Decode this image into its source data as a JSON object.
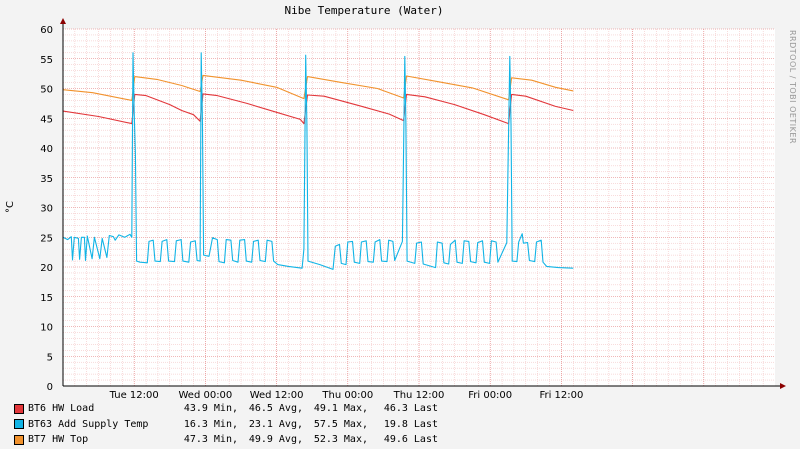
{
  "chart_data": {
    "type": "line",
    "title": "Nibe Temperature (Water)",
    "ylabel": "°C",
    "xlabel": "",
    "watermark": "RRDTOOL / TOBI OETIKER",
    "ylim": [
      0,
      60
    ],
    "y_ticks": [
      "0",
      "5",
      "10",
      "15",
      "20",
      "25",
      "30",
      "35",
      "40",
      "45",
      "50",
      "55",
      "60"
    ],
    "xlim": [
      0,
      120
    ],
    "x_ticks": [
      {
        "x": 12,
        "label": "Tue 12:00"
      },
      {
        "x": 24,
        "label": "Wed 00:00"
      },
      {
        "x": 36,
        "label": "Wed 12:00"
      },
      {
        "x": 48,
        "label": "Thu 00:00"
      },
      {
        "x": 60,
        "label": "Thu 12:00"
      },
      {
        "x": 72,
        "label": "Fri 00:00"
      },
      {
        "x": 84,
        "label": "Fri 12:00"
      }
    ],
    "grid": true,
    "background": "#ffffff",
    "grid_color": "#f0b8b8",
    "major_grid_color": "#e07070",
    "series": [
      {
        "name": "BT6 HW Load",
        "color": "#e2373b",
        "stats": {
          "min": "43.9 Min,",
          "avg": "46.5 Avg,",
          "max": "49.1 Max,",
          "last": "46.3 Last"
        },
        "points": [
          [
            0,
            46.2
          ],
          [
            6,
            45.3
          ],
          [
            11.6,
            44.1
          ],
          [
            12.1,
            49.0
          ],
          [
            14,
            48.8
          ],
          [
            18,
            47.3
          ],
          [
            20,
            46.3
          ],
          [
            22,
            45.6
          ],
          [
            23.1,
            44.5
          ],
          [
            23.6,
            49.1
          ],
          [
            26,
            48.8
          ],
          [
            31,
            47.5
          ],
          [
            36,
            46.0
          ],
          [
            40,
            44.8
          ],
          [
            40.6,
            44.1
          ],
          [
            41.2,
            48.9
          ],
          [
            44,
            48.7
          ],
          [
            50,
            47.1
          ],
          [
            55,
            45.7
          ],
          [
            57.4,
            44.6
          ],
          [
            57.9,
            49.0
          ],
          [
            61,
            48.6
          ],
          [
            66,
            47.3
          ],
          [
            71,
            45.6
          ],
          [
            75.1,
            44.1
          ],
          [
            75.6,
            49.0
          ],
          [
            78,
            48.7
          ],
          [
            83,
            47.0
          ],
          [
            86,
            46.3
          ]
        ]
      },
      {
        "name": "BT7 HW Top",
        "color": "#f1922d",
        "stats": {
          "min": "47.3 Min,",
          "avg": "49.9 Avg,",
          "max": "52.3 Max,",
          "last": "49.6 Last"
        },
        "points": [
          [
            0,
            49.8
          ],
          [
            5,
            49.3
          ],
          [
            11.6,
            48.0
          ],
          [
            12.1,
            52.0
          ],
          [
            16,
            51.5
          ],
          [
            20,
            50.5
          ],
          [
            23.1,
            49.5
          ],
          [
            23.6,
            52.2
          ],
          [
            30,
            51.4
          ],
          [
            36,
            50.2
          ],
          [
            40.6,
            48.3
          ],
          [
            41.2,
            52.0
          ],
          [
            47,
            51.0
          ],
          [
            53,
            50.0
          ],
          [
            57.4,
            48.4
          ],
          [
            57.9,
            52.1
          ],
          [
            63,
            51.2
          ],
          [
            69,
            50.1
          ],
          [
            75.1,
            48.1
          ],
          [
            75.6,
            51.8
          ],
          [
            79,
            51.4
          ],
          [
            83,
            50.2
          ],
          [
            86,
            49.6
          ]
        ]
      },
      {
        "name": "BT63 Add Supply Temp",
        "color": "#11b4e6",
        "stats": {
          "min": "16.3 Min,",
          "avg": "23.1 Avg,",
          "max": "57.5 Max,",
          "last": "19.8 Last"
        },
        "spikes": [
          11.8,
          23.3,
          40.9,
          57.6,
          75.3
        ],
        "points": [
          [
            0,
            25
          ],
          [
            0.8,
            24.6
          ],
          [
            1.4,
            25.1
          ],
          [
            1.6,
            21.2
          ],
          [
            1.9,
            25
          ],
          [
            2.6,
            24.8
          ],
          [
            2.8,
            21.3
          ],
          [
            3.1,
            25
          ],
          [
            3.6,
            25
          ],
          [
            3.8,
            21.1
          ],
          [
            4.1,
            25.2
          ],
          [
            4.9,
            21.4
          ],
          [
            5.3,
            25
          ],
          [
            6.2,
            21.4
          ],
          [
            6.6,
            24.8
          ],
          [
            7.4,
            21.6
          ],
          [
            7.8,
            25.3
          ],
          [
            8.5,
            25.1
          ],
          [
            8.8,
            24.5
          ],
          [
            9.4,
            25.4
          ],
          [
            10.4,
            25
          ],
          [
            11.3,
            25.5
          ],
          [
            11.6,
            25
          ],
          [
            11.8,
            56
          ],
          [
            12.0,
            46
          ],
          [
            12.2,
            39
          ],
          [
            12.4,
            21
          ],
          [
            13,
            20.8
          ],
          [
            14.2,
            20.7
          ],
          [
            14.5,
            24.3
          ],
          [
            15.2,
            24.5
          ],
          [
            15.5,
            21.0
          ],
          [
            16.4,
            20.9
          ],
          [
            16.7,
            24.3
          ],
          [
            17.5,
            24.6
          ],
          [
            17.8,
            21.0
          ],
          [
            18.8,
            20.9
          ],
          [
            19.1,
            24.4
          ],
          [
            19.9,
            24.6
          ],
          [
            20.2,
            21.0
          ],
          [
            21.2,
            20.8
          ],
          [
            21.5,
            24.2
          ],
          [
            22.3,
            24.4
          ],
          [
            22.6,
            21.1
          ],
          [
            23.1,
            21
          ],
          [
            23.3,
            56
          ],
          [
            23.5,
            45
          ],
          [
            23.7,
            22
          ],
          [
            24.6,
            21.8
          ],
          [
            25.2,
            24.9
          ],
          [
            26.0,
            24.6
          ],
          [
            26.3,
            20.9
          ],
          [
            27.2,
            20.7
          ],
          [
            27.5,
            24.6
          ],
          [
            28.3,
            24.5
          ],
          [
            28.6,
            21.1
          ],
          [
            29.5,
            20.8
          ],
          [
            29.8,
            24.5
          ],
          [
            30.6,
            24.6
          ],
          [
            30.9,
            21
          ],
          [
            31.8,
            20.8
          ],
          [
            32.1,
            24.3
          ],
          [
            32.9,
            24.5
          ],
          [
            33.2,
            21.1
          ],
          [
            34.1,
            20.9
          ],
          [
            34.4,
            24.5
          ],
          [
            35.2,
            24.3
          ],
          [
            35.5,
            21
          ],
          [
            36.2,
            20.4
          ],
          [
            38,
            20.1
          ],
          [
            40.3,
            19.8
          ],
          [
            40.6,
            23
          ],
          [
            40.9,
            55.6
          ],
          [
            41.1,
            44
          ],
          [
            41.3,
            21
          ],
          [
            43.3,
            20.4
          ],
          [
            45.5,
            19.6
          ],
          [
            45.9,
            23.5
          ],
          [
            46.6,
            23.8
          ],
          [
            46.9,
            20.6
          ],
          [
            47.7,
            20.4
          ],
          [
            48,
            24.2
          ],
          [
            48.8,
            24.3
          ],
          [
            49.1,
            20.8
          ],
          [
            50,
            20.6
          ],
          [
            50.3,
            24.2
          ],
          [
            51.1,
            24.4
          ],
          [
            51.4,
            20.9
          ],
          [
            52.3,
            20.8
          ],
          [
            52.6,
            24.2
          ],
          [
            53.4,
            24.6
          ],
          [
            53.7,
            21
          ],
          [
            54.6,
            20.9
          ],
          [
            54.9,
            24.5
          ],
          [
            55.6,
            24.3
          ],
          [
            55.9,
            21.1
          ],
          [
            57.2,
            24.3
          ],
          [
            57.6,
            55.4
          ],
          [
            57.8,
            44
          ],
          [
            58,
            21
          ],
          [
            59.3,
            20.6
          ],
          [
            59.6,
            24
          ],
          [
            60.4,
            24.2
          ],
          [
            60.7,
            20.5
          ],
          [
            62.8,
            19.9
          ],
          [
            63.1,
            24.2
          ],
          [
            63.9,
            24
          ],
          [
            64.2,
            20.7
          ],
          [
            65,
            20.5
          ],
          [
            65.3,
            23.8
          ],
          [
            66.1,
            24.5
          ],
          [
            66.4,
            20.8
          ],
          [
            67.3,
            20.6
          ],
          [
            67.6,
            24.4
          ],
          [
            68.4,
            24.3
          ],
          [
            68.7,
            20.9
          ],
          [
            69.6,
            20.7
          ],
          [
            69.9,
            24.1
          ],
          [
            70.7,
            24.4
          ],
          [
            71,
            20.8
          ],
          [
            71.9,
            20.6
          ],
          [
            72.2,
            24.4
          ],
          [
            73,
            24.2
          ],
          [
            73.3,
            20.8
          ],
          [
            74.8,
            24.1
          ],
          [
            75.3,
            55.4
          ],
          [
            75.5,
            44
          ],
          [
            75.7,
            21
          ],
          [
            76.5,
            20.9
          ],
          [
            76.8,
            24.2
          ],
          [
            77.4,
            25.6
          ],
          [
            77.6,
            24
          ],
          [
            78.3,
            24.1
          ],
          [
            78.6,
            21.1
          ],
          [
            79.5,
            20.9
          ],
          [
            79.8,
            24.2
          ],
          [
            80.6,
            24.5
          ],
          [
            80.9,
            20.8
          ],
          [
            81.5,
            20.1
          ],
          [
            83.5,
            19.9
          ],
          [
            86,
            19.8
          ]
        ]
      }
    ]
  }
}
